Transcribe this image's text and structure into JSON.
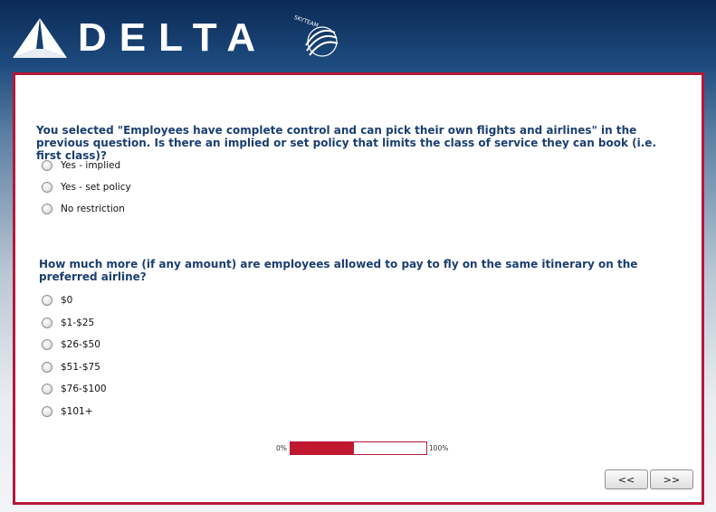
{
  "header": {
    "brand": "DELTA",
    "alliance": "SKYTEAM"
  },
  "questions": [
    {
      "text": "You selected \"Employees have complete control and can pick their own flights and airlines\" in the previous question. Is there an implied or set policy that limits the class of service they can book (i.e. first class)?",
      "options": [
        "Yes - implied",
        "Yes - set policy",
        "No restriction"
      ]
    },
    {
      "text": " How much more (if any amount) are employees allowed to pay to fly on the same itinerary on the preferred airline?",
      "options": [
        "$0",
        "$1-$25",
        "$26-$50",
        "$51-$75",
        "$76-$100",
        "$101+"
      ]
    }
  ],
  "progress": {
    "start_label": "0%",
    "end_label": "100%",
    "fraction": 0.47
  },
  "nav": {
    "prev_label": "<<",
    "next_label": ">>"
  },
  "colors": {
    "brand_red": "#b5183a",
    "progress_fill": "#c1182f",
    "question_text": "#1b3f70"
  }
}
